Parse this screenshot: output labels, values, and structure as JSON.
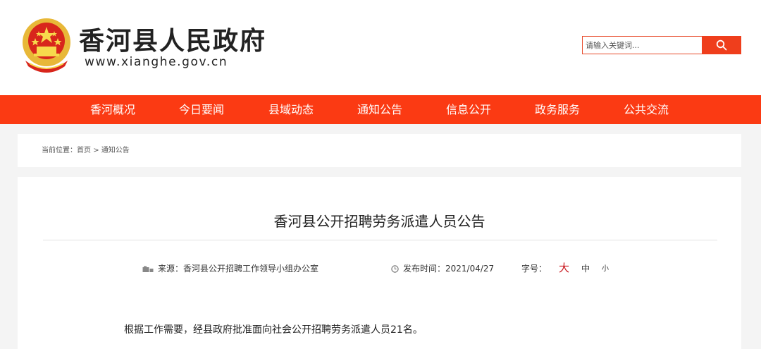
{
  "header": {
    "site_title": "香河县人民政府",
    "site_url": "www.xianghe.gov.cn",
    "emblem_icon": "national-emblem-icon"
  },
  "search": {
    "placeholder": "请输入关键词...",
    "button_icon": "search-icon"
  },
  "nav": {
    "items": [
      {
        "label": "香河概况"
      },
      {
        "label": "今日要闻"
      },
      {
        "label": "县域动态"
      },
      {
        "label": "通知公告"
      },
      {
        "label": "信息公开"
      },
      {
        "label": "政务服务"
      },
      {
        "label": "公共交流"
      }
    ]
  },
  "breadcrumb": {
    "prefix": "当前位置：",
    "home": "首页",
    "separator": ">",
    "current": "通知公告"
  },
  "article": {
    "title": "香河县公开招聘劳务派遣人员公告",
    "source_label": "来源：",
    "source": "香河县公开招聘工作领导小组办公室",
    "date_label": "发布时间：",
    "date": "2021/04/27",
    "font_size_label": "字号：",
    "font_large": "大",
    "font_medium": "中",
    "font_small": "小",
    "first_paragraph": "根据工作需要，经县政府批准面向社会公开招聘劳务派遣人员21名。"
  },
  "colors": {
    "nav_background": "#fb3a13",
    "search_button": "#ef3e1c",
    "font_large_active": "#c8161d"
  }
}
